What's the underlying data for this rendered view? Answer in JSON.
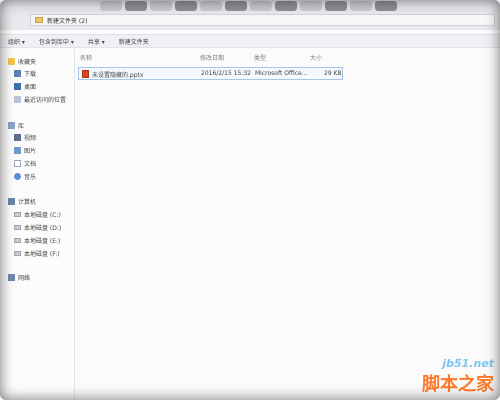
{
  "window": {
    "address_path": "新建文件夹 (2)"
  },
  "toolbar": {
    "organize": "组织 ▾",
    "include_in_library": "包含到库中 ▾",
    "share": "共享 ▾",
    "new_folder": "新建文件夹"
  },
  "sidebar": {
    "favorites": "收藏夹",
    "downloads": "下载",
    "desktop": "桌面",
    "recent": "最近访问的位置",
    "libraries": "库",
    "videos": "视频",
    "pictures": "图片",
    "documents": "文档",
    "music": "音乐",
    "computer": "计算机",
    "drives": [
      "本地磁盘 (C:)",
      "本地磁盘 (D:)",
      "本地磁盘 (E:)",
      "本地磁盘 (F:)"
    ],
    "network": "网络"
  },
  "columns": {
    "name": "名称",
    "date": "修改日期",
    "type": "类型",
    "size": "大小"
  },
  "files": [
    {
      "name": "未设置隐藏的.pptx",
      "date": "2016/2/15 15:32",
      "type": "Microsoft Office...",
      "size": "29 KB"
    }
  ],
  "watermark": {
    "site": "jb51.net",
    "name": "脚本之家"
  },
  "icons": {
    "favorites": "star-icon",
    "folder": "folder-icon",
    "file": "powerpoint-file-icon"
  }
}
